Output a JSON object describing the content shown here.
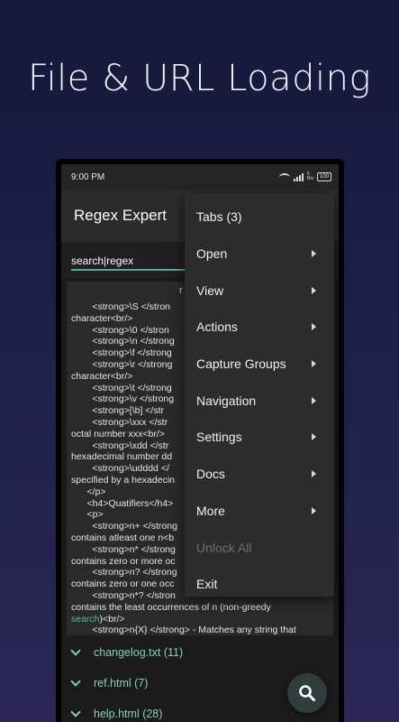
{
  "headline": "File & URL Loading",
  "status": {
    "time": "9:00 PM",
    "network_speed": "0\nB/s",
    "battery": "100"
  },
  "app": {
    "title": "Regex Expert"
  },
  "search": {
    "value": "search|regex"
  },
  "code_panel": {
    "header_fragment": "r",
    "lines": [
      "        <strong>\\S </stron",
      "character<br/>",
      "        <strong>\\0 </stron",
      "        <strong>\\n </strong",
      "        <strong>\\f </strong",
      "        <strong>\\r </strong",
      "character<br/>",
      "        <strong>\\t </strong",
      "        <strong>\\v </strong",
      "        <strong>[\\b] </str",
      "        <strong>\\xxx </str",
      "octal number xxx<br/>",
      "        <strong>\\xdd </str",
      "hexadecimal number dd",
      "        <strong>\\udddd </",
      "specified by a hexadecin",
      "      </p>",
      "      <h4>Quatifiers</h4>",
      "      <p>",
      "        <strong>n+ </strong",
      "contains atleast one n<b",
      "        <strong>n* </strong",
      "contains zero or more oc",
      "        <strong>n? </strong",
      "contains zero or one occ",
      "        <strong>n*? </stron",
      "contains the least occurrences of n (non-greedy",
      "search)<br/>",
      "        <strong>n{X} </strong> - Matches any string that"
    ],
    "highlight_word": "search"
  },
  "files": [
    {
      "label": "changelog.txt (11)"
    },
    {
      "label": "ref.html (7)"
    },
    {
      "label": "help.html (28)"
    }
  ],
  "menu": {
    "items": [
      {
        "label": "Tabs (3)",
        "submenu": false,
        "enabled": true
      },
      {
        "label": "Open",
        "submenu": true,
        "enabled": true
      },
      {
        "label": "View",
        "submenu": true,
        "enabled": true
      },
      {
        "label": "Actions",
        "submenu": true,
        "enabled": true
      },
      {
        "label": "Capture Groups",
        "submenu": true,
        "enabled": true
      },
      {
        "label": "Navigation",
        "submenu": true,
        "enabled": true
      },
      {
        "label": "Settings",
        "submenu": true,
        "enabled": true
      },
      {
        "label": "Docs",
        "submenu": true,
        "enabled": true
      },
      {
        "label": "More",
        "submenu": true,
        "enabled": true
      },
      {
        "label": "Unlock All",
        "submenu": false,
        "enabled": false
      },
      {
        "label": "Exit",
        "submenu": false,
        "enabled": true
      }
    ]
  },
  "icons": {
    "fab": "search-icon",
    "file_toggle": "chevron-down-icon",
    "submenu": "caret-right-icon"
  },
  "colors": {
    "accent": "#5aa89a",
    "file_label": "#7fd3b0",
    "highlight": "#4cc28f"
  }
}
